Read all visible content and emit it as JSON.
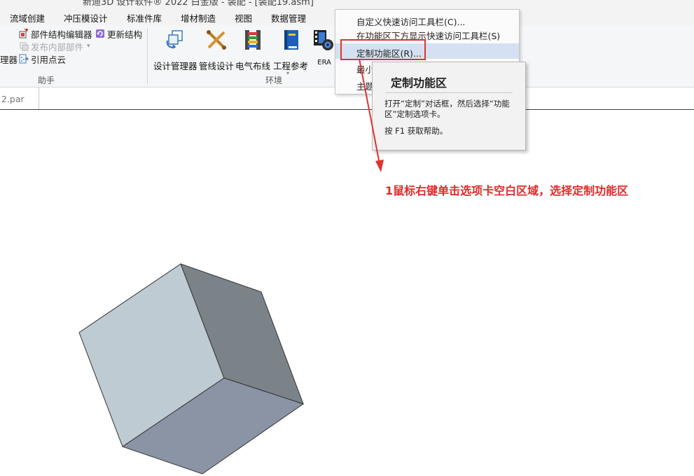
{
  "title_bar": {
    "text": "新迪3D 设计软件® 2022 白金版 - 装配 - [装配19.asm]"
  },
  "tabs": [
    "流域创建",
    "冲压模设计",
    "标准件库",
    "增材制造",
    "视图",
    "数据管理"
  ],
  "ribbon": {
    "assistant_group": {
      "label": "助手",
      "items": [
        {
          "label": "部件结构编辑器",
          "icon": "structure-editor-icon"
        },
        {
          "label": "更新结构",
          "icon": "update-structure-icon"
        },
        {
          "label": "发布内部部件",
          "icon": "publish-parts-icon",
          "disabled": true,
          "has_dropdown": true
        },
        {
          "label": "引用点云",
          "icon": "point-cloud-icon"
        }
      ],
      "cut_label": "理器"
    },
    "environment_group": {
      "label": "环境",
      "buttons": [
        {
          "label": "设计管理器",
          "icon": "design-manager-icon"
        },
        {
          "label": "管线设计",
          "icon": "pipe-design-icon"
        },
        {
          "label": "电气布线",
          "icon": "electrical-wiring-icon"
        },
        {
          "label": "工程参考",
          "icon": "engineering-reference-icon"
        },
        {
          "label": "ERA",
          "icon": "era-icon"
        }
      ]
    }
  },
  "document_tab": {
    "label": "2.par"
  },
  "context_menu": {
    "items": [
      {
        "label": "自定义快速访问工具栏(C)..."
      },
      {
        "label": "在功能区下方显示快速访问工具栏(S)"
      },
      {
        "label": "定制功能区(R)...",
        "highlighted": true
      },
      {
        "label": "最小"
      },
      {
        "label": "主题"
      }
    ]
  },
  "tooltip": {
    "title": "定制功能区",
    "description": "打开“定制”对话框，然后选择“功能区”定制选项卡。",
    "help": "按 F1 获取帮助。"
  },
  "annotation": {
    "text": "1鼠标右键单击选项卡空白区域，选择定制功能区",
    "color": "#e02a2a"
  }
}
